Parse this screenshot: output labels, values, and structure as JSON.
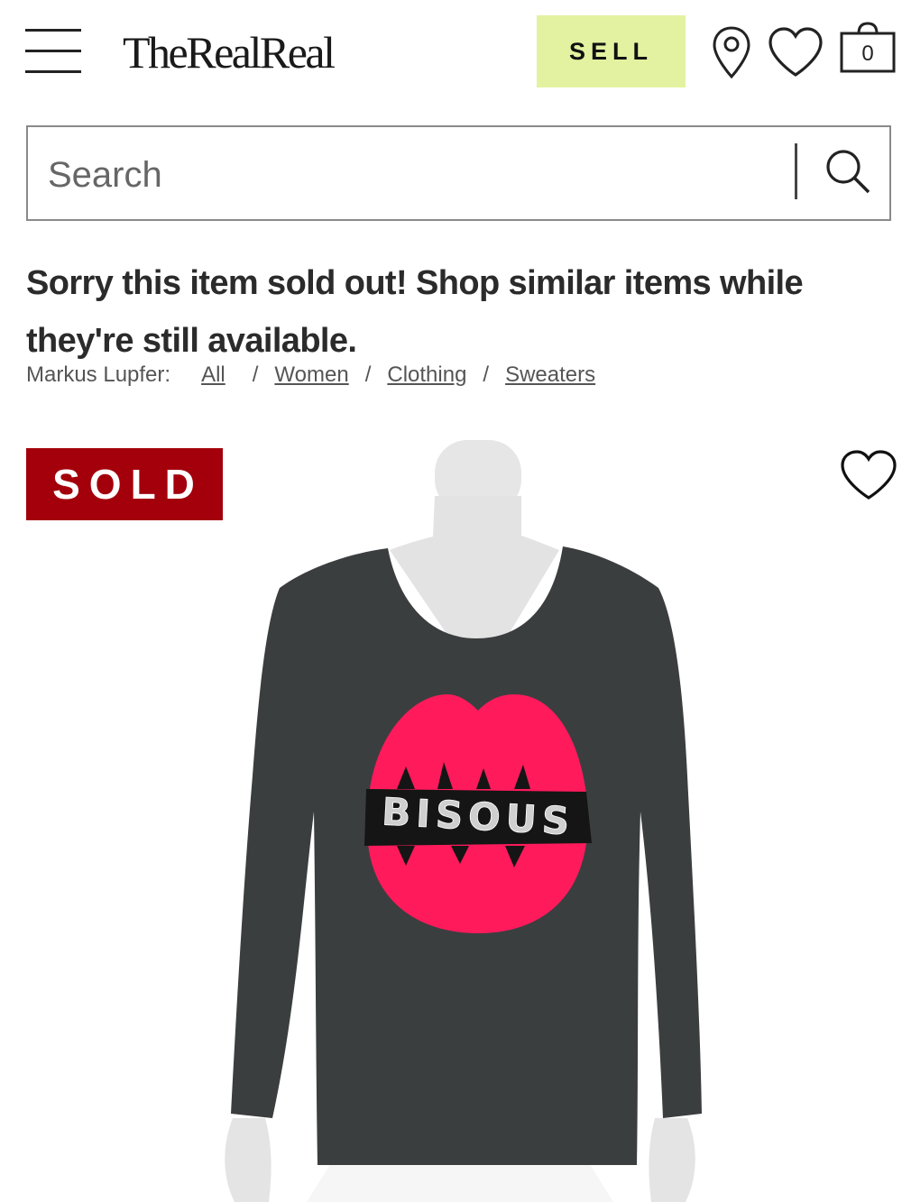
{
  "header": {
    "logo": "TheRealReal",
    "sell_label": "SELL",
    "bag_count": "0",
    "icons": [
      "menu-icon",
      "location-pin-icon",
      "heart-icon",
      "shopping-bag-icon"
    ]
  },
  "search": {
    "placeholder": "Search",
    "value": "",
    "icon": "search-icon"
  },
  "message": "Sorry this item sold out! Shop similar items while they're still available.",
  "breadcrumb": {
    "brand": "Markus Lupfer:",
    "items": [
      "All",
      "Women",
      "Clothing",
      "Sweaters"
    ],
    "separator": "/"
  },
  "product": {
    "status_badge": "SOLD",
    "sweater_text": "BISOUS"
  },
  "colors": {
    "sell_bg": "#e2f2a0",
    "sold_badge_bg": "#a3000b",
    "sweater": "#3b3e3f",
    "lips": "#ff1a5c"
  }
}
